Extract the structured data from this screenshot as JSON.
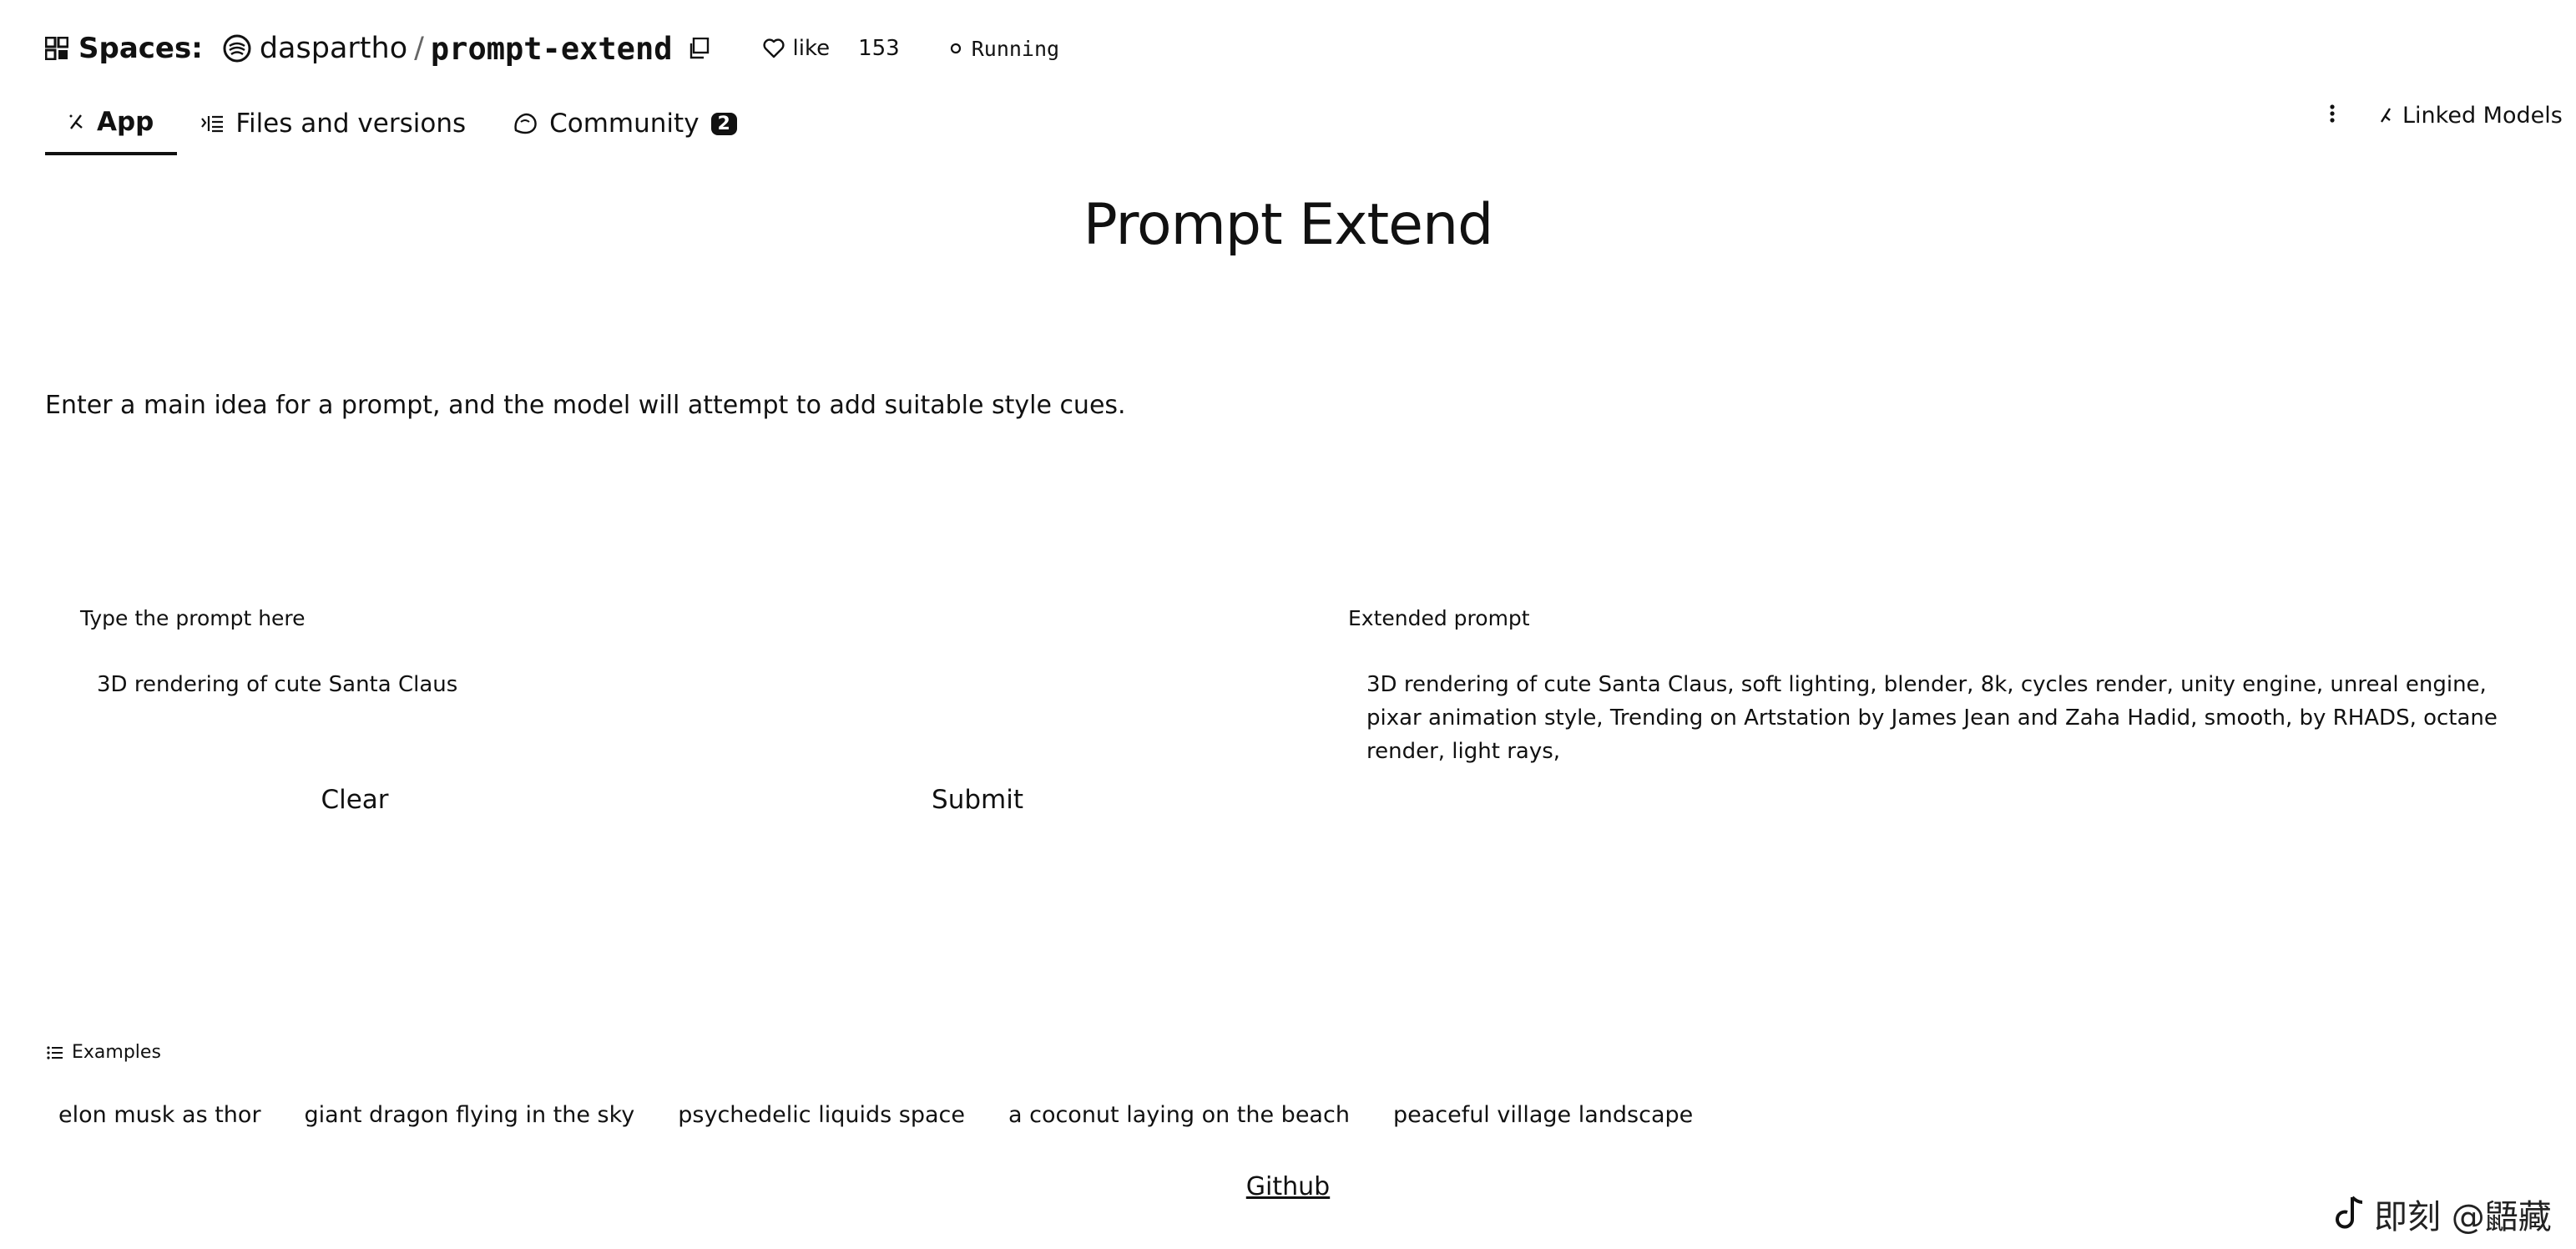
{
  "header": {
    "spaces_label": "Spaces:",
    "owner": "daspartho",
    "slash": "/",
    "repo": "prompt-extend",
    "like_label": "like",
    "like_count": "153",
    "status": "Running"
  },
  "tabs": [
    {
      "label": "App",
      "icon": "app-icon",
      "active": true
    },
    {
      "label": "Files and versions",
      "icon": "files-icon",
      "active": false
    },
    {
      "label": "Community",
      "icon": "community-icon",
      "active": false,
      "badge": "2"
    }
  ],
  "toolbar": {
    "linked_models": "Linked Models"
  },
  "main": {
    "title": "Prompt Extend",
    "description": "Enter a main idea for a prompt, and the model will attempt to add suitable style cues.",
    "input": {
      "label": "Type the prompt here",
      "value": "3D rendering of cute Santa Claus"
    },
    "output": {
      "label": "Extended prompt",
      "value": "3D rendering of cute Santa Claus, soft lighting, blender, 8k, cycles render, unity engine, unreal engine, pixar animation style, Trending on Artstation by James Jean and Zaha Hadid, smooth, by RHADS, octane render, light rays,"
    },
    "buttons": {
      "clear": "Clear",
      "submit": "Submit"
    }
  },
  "examples": {
    "heading": "Examples",
    "items": [
      "elon musk as thor",
      "giant dragon flying in the sky",
      "psychedelic liquids space",
      "a coconut laying on the beach",
      "peaceful village landscape"
    ]
  },
  "footer": {
    "github": "Github"
  },
  "watermark": {
    "text": "即刻 @鼯藏"
  }
}
